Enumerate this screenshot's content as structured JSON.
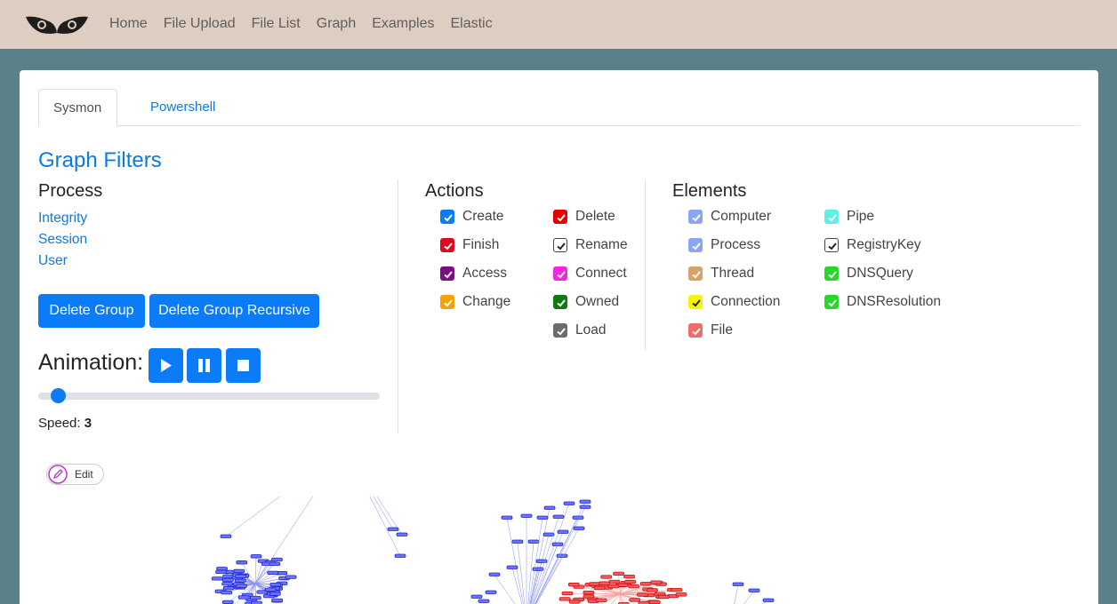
{
  "navbar": {
    "logo_icon": "owl-eyes-logo",
    "links": [
      "Home",
      "File Upload",
      "File List",
      "Graph",
      "Examples",
      "Elastic"
    ]
  },
  "tabs": [
    "Sysmon",
    "Powershell"
  ],
  "filters": {
    "title": "Graph Filters",
    "process": {
      "heading": "Process",
      "links": [
        "Integrity",
        "Session",
        "User"
      ],
      "buttons": [
        "Delete Group",
        "Delete Group Recursive"
      ]
    },
    "animation": {
      "label": "Animation:",
      "controls": [
        "play-icon",
        "pause-icon",
        "stop-icon"
      ],
      "speed_label": "Speed:",
      "speed_value": "3",
      "slider_fraction": 0.04
    },
    "actions": {
      "heading": "Actions",
      "items": [
        {
          "label": "Create",
          "color": "#0b7bf7",
          "checked": true
        },
        {
          "label": "Finish",
          "color": "#e0081f",
          "checked": true
        },
        {
          "label": "Access",
          "color": "#7a0f82",
          "checked": true
        },
        {
          "label": "Change",
          "color": "#f5a201",
          "checked": true
        },
        {
          "label": "Delete",
          "color": "#e60000",
          "checked": true
        },
        {
          "label": "Rename",
          "color": "#ffffff",
          "checked": true
        },
        {
          "label": "Connect",
          "color": "#f227de",
          "checked": true
        },
        {
          "label": "Owned",
          "color": "#0f7a0f",
          "checked": true
        },
        {
          "label": "Load",
          "color": "#6c6c6c",
          "checked": true
        }
      ]
    },
    "elements": {
      "heading": "Elements",
      "items": [
        {
          "label": "Computer",
          "color": "#8aa4f0",
          "checked": true
        },
        {
          "label": "Process",
          "color": "#8aa4f0",
          "checked": true
        },
        {
          "label": "Thread",
          "color": "#d8a36a",
          "checked": true
        },
        {
          "label": "Connection",
          "color": "#f5f50a",
          "checked": true
        },
        {
          "label": "File",
          "color": "#f26b6b",
          "checked": true
        },
        {
          "label": "Pipe",
          "color": "#5ef0e6",
          "checked": true
        },
        {
          "label": "RegistryKey",
          "color": "#ffffff",
          "checked": true
        },
        {
          "label": "DNSQuery",
          "color": "#28d828",
          "checked": true
        },
        {
          "label": "DNSResolution",
          "color": "#28d828",
          "checked": true
        }
      ]
    }
  },
  "graph": {
    "edit_label": "Edit",
    "edit_icon": "pencil-icon"
  }
}
